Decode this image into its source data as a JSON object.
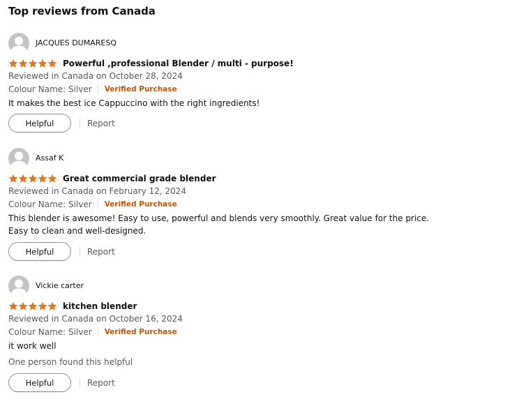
{
  "section": {
    "title": "Top reviews from Canada"
  },
  "colors": {
    "star": "#de7921",
    "verified": "#c45500",
    "secondary_text": "#565959",
    "avatar_bg": "#c4c4c4",
    "avatar_fg": "#ffffff"
  },
  "icons": {
    "avatar": "person-silhouette-icon",
    "star": "filled-star-icon"
  },
  "reviews": [
    {
      "reviewer": "JACQUES DUMARESQ",
      "rating": 5,
      "title": "Powerful ,professional Blender / multi - purpose!",
      "date": "Reviewed in Canada on October 28, 2024",
      "variant": "Colour Name: Silver",
      "verified": "Verified Purchase",
      "body": "It makes the best ice Cappuccino with the right ingredients!",
      "helpful_count": "",
      "helpful_label": "Helpful",
      "report_label": "Report"
    },
    {
      "reviewer": "Assaf K",
      "rating": 5,
      "title": "Great commercial grade blender",
      "date": "Reviewed in Canada on February 12, 2024",
      "variant": "Colour Name: Silver",
      "verified": "Verified Purchase",
      "body": "This blender is awesome! Easy to use, powerful and blends very smoothly. Great value for the price. Easy to clean and well-designed.",
      "helpful_count": "",
      "helpful_label": "Helpful",
      "report_label": "Report"
    },
    {
      "reviewer": "Vickie carter",
      "rating": 5,
      "title": "kitchen blender",
      "date": "Reviewed in Canada on October 16, 2024",
      "variant": "Colour Name: Silver",
      "verified": "Verified Purchase",
      "body": "it work well",
      "helpful_count": "One person found this helpful",
      "helpful_label": "Helpful",
      "report_label": "Report"
    }
  ]
}
